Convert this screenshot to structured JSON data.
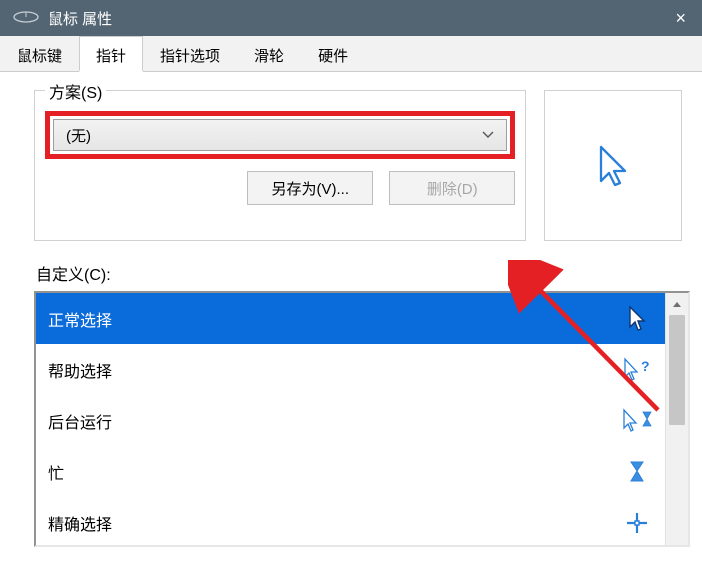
{
  "window": {
    "title": "鼠标 属性",
    "close": "×"
  },
  "tabs": [
    {
      "label": "鼠标键"
    },
    {
      "label": "指针"
    },
    {
      "label": "指针选项"
    },
    {
      "label": "滑轮"
    },
    {
      "label": "硬件"
    }
  ],
  "active_tab": 1,
  "scheme": {
    "label": "方案(S)",
    "selected": "(无)",
    "save_as": "另存为(V)...",
    "delete": "删除(D)"
  },
  "customize_label": "自定义(C):",
  "cursor_list": [
    {
      "label": "正常选择",
      "icon": "arrow-white",
      "selected": true
    },
    {
      "label": "帮助选择",
      "icon": "arrow-help",
      "selected": false
    },
    {
      "label": "后台运行",
      "icon": "arrow-busy",
      "selected": false
    },
    {
      "label": "忙",
      "icon": "hourglass",
      "selected": false
    },
    {
      "label": "精确选择",
      "icon": "crosshair",
      "selected": false
    }
  ],
  "colors": {
    "highlight": "#e52024",
    "selection": "#0a6bda",
    "titlebar": "#536573"
  }
}
